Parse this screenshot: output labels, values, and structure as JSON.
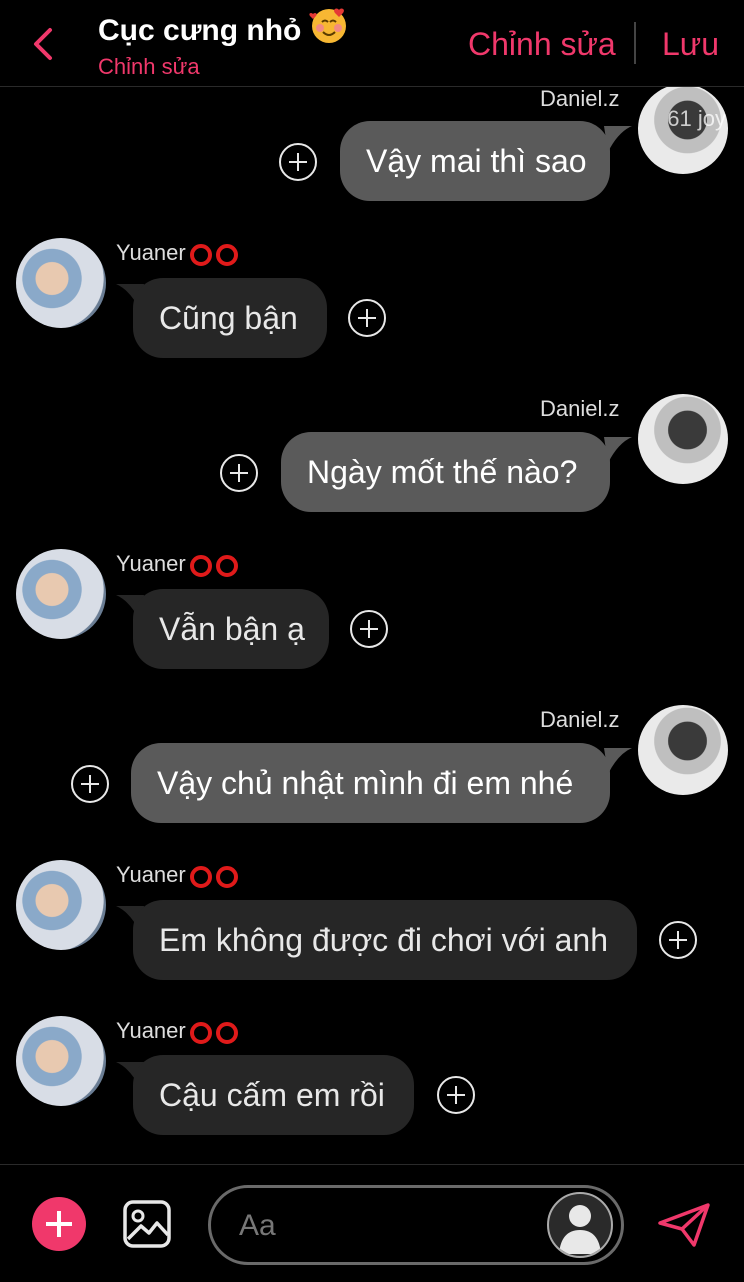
{
  "header": {
    "title": "Cục cưng nhỏ",
    "subtitle": "Chỉnh sửa",
    "edit_label": "Chỉnh sửa",
    "save_label": "Lưu",
    "accent": "#f0386b"
  },
  "messages": [
    {
      "sender": "Daniel.z",
      "text": "Vậy mai thì sao",
      "side": "right",
      "watermark": "61 joy"
    },
    {
      "sender": "Yuaner",
      "text": "Cũng bận",
      "side": "left"
    },
    {
      "sender": "Daniel.z",
      "text": "Ngày mốt thế nào?",
      "side": "right"
    },
    {
      "sender": "Yuaner",
      "text": "Vẫn bận ạ",
      "side": "left"
    },
    {
      "sender": "Daniel.z",
      "text": "Vậy chủ nhật mình đi em nhé",
      "side": "right"
    },
    {
      "sender": "Yuaner",
      "text": "Em không được đi chơi với anh",
      "side": "left"
    },
    {
      "sender": "Yuaner",
      "text": "Cậu cấm em rồi",
      "side": "left"
    }
  ],
  "composer": {
    "placeholder": "Aa"
  },
  "icons": [
    "back-chevron-icon",
    "smiling-face-with-hearts-icon",
    "plus-icon",
    "image-icon",
    "send-icon"
  ]
}
